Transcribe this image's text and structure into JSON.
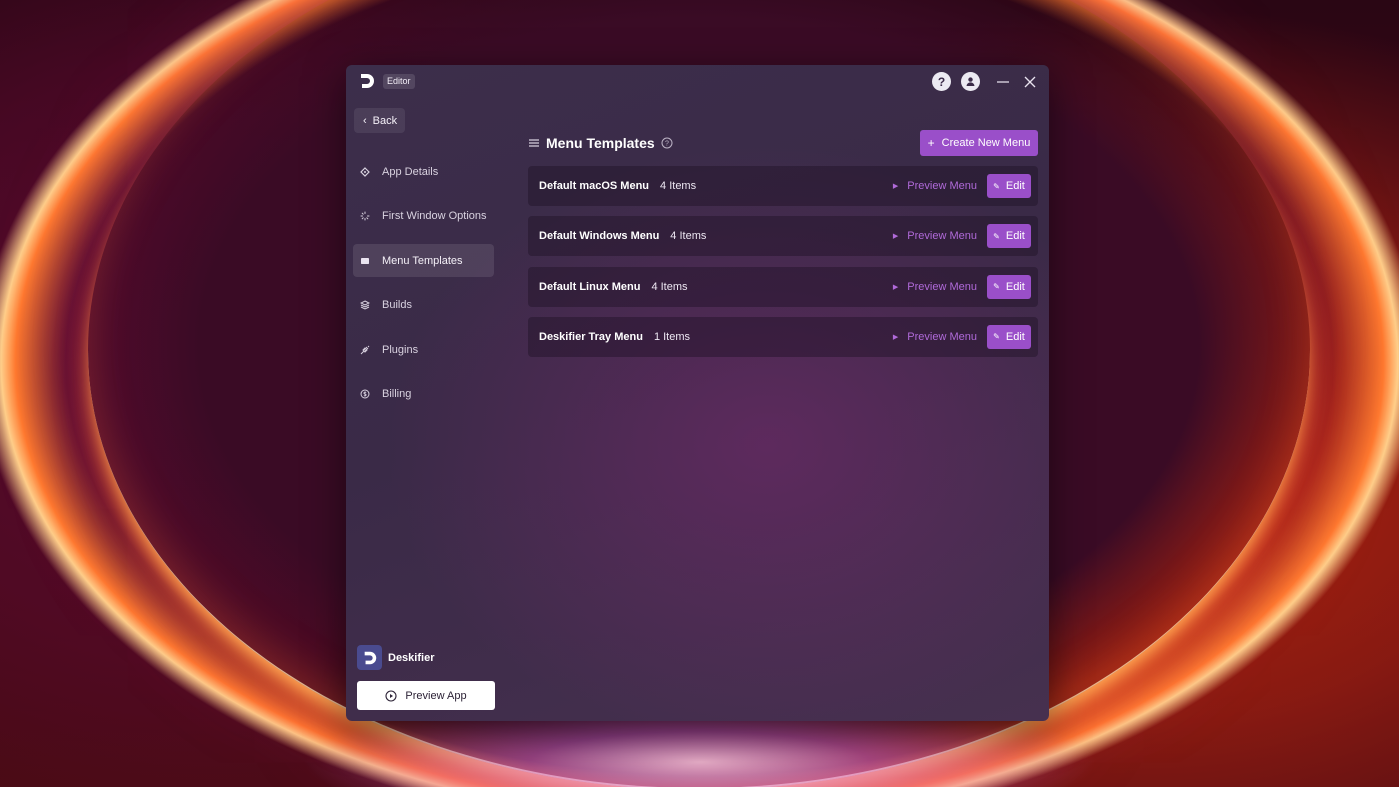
{
  "titlebar": {
    "badge": "Editor",
    "icons": [
      "app-logo-icon",
      "help-icon",
      "user-icon",
      "minimize-icon",
      "close-icon"
    ]
  },
  "back_label": "Back",
  "sidebar": {
    "items": [
      {
        "label": "App Details",
        "icon": "diamond-icon",
        "active": false
      },
      {
        "label": "First Window Options",
        "icon": "loader-icon",
        "active": false
      },
      {
        "label": "Menu Templates",
        "icon": "menu-icon",
        "active": true
      },
      {
        "label": "Builds",
        "icon": "layers-icon",
        "active": false
      },
      {
        "label": "Plugins",
        "icon": "plug-icon",
        "active": false
      },
      {
        "label": "Billing",
        "icon": "dollar-icon",
        "active": false
      }
    ]
  },
  "brand": {
    "name": "Deskifier"
  },
  "preview_app_label": "Preview App",
  "main": {
    "title": "Menu Templates",
    "create_label": "Create New Menu",
    "preview_label": "Preview Menu",
    "edit_label": "Edit",
    "menus": [
      {
        "name": "Default macOS Menu",
        "count": "4 Items"
      },
      {
        "name": "Default Windows Menu",
        "count": "4 Items"
      },
      {
        "name": "Default Linux Menu",
        "count": "4 Items"
      },
      {
        "name": "Deskifier Tray Menu",
        "count": "1 Items"
      }
    ]
  },
  "colors": {
    "accent": "#9a4fc9",
    "link": "#b06ad9",
    "window_bg": "#3c2e4b"
  }
}
